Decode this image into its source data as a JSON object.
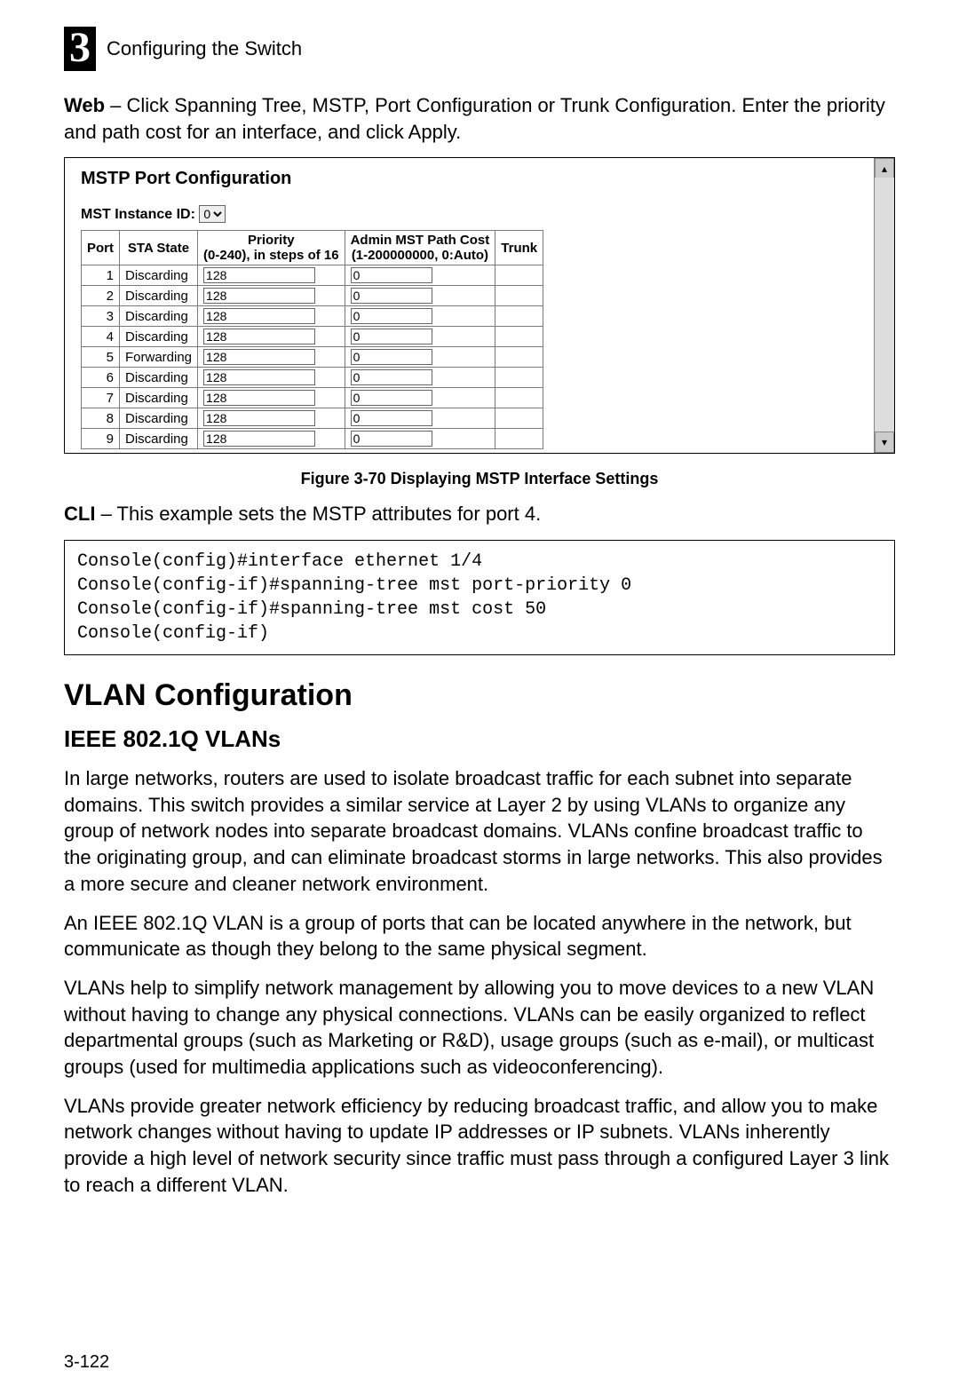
{
  "header": {
    "chapter_number": "3",
    "chapter_title": "Configuring the Switch"
  },
  "intro": {
    "label": "Web",
    "text": " – Click Spanning Tree, MSTP, Port Configuration or Trunk Configuration. Enter the priority and path cost for an interface, and click Apply."
  },
  "screenshot": {
    "title": "MSTP Port Configuration",
    "mst_label": "MST Instance ID:",
    "mst_value": "0",
    "columns": {
      "port": "Port",
      "sta_state": "STA State",
      "priority_l1": "Priority",
      "priority_l2": "(0-240), in steps of 16",
      "path_l1": "Admin MST Path Cost",
      "path_l2": "(1-200000000, 0:Auto)",
      "trunk": "Trunk"
    },
    "rows": [
      {
        "port": "1",
        "state": "Discarding",
        "priority": "128",
        "cost": "0",
        "trunk": ""
      },
      {
        "port": "2",
        "state": "Discarding",
        "priority": "128",
        "cost": "0",
        "trunk": ""
      },
      {
        "port": "3",
        "state": "Discarding",
        "priority": "128",
        "cost": "0",
        "trunk": ""
      },
      {
        "port": "4",
        "state": "Discarding",
        "priority": "128",
        "cost": "0",
        "trunk": ""
      },
      {
        "port": "5",
        "state": "Forwarding",
        "priority": "128",
        "cost": "0",
        "trunk": ""
      },
      {
        "port": "6",
        "state": "Discarding",
        "priority": "128",
        "cost": "0",
        "trunk": ""
      },
      {
        "port": "7",
        "state": "Discarding",
        "priority": "128",
        "cost": "0",
        "trunk": ""
      },
      {
        "port": "8",
        "state": "Discarding",
        "priority": "128",
        "cost": "0",
        "trunk": ""
      },
      {
        "port": "9",
        "state": "Discarding",
        "priority": "128",
        "cost": "0",
        "trunk": ""
      }
    ]
  },
  "figure_caption": "Figure 3-70  Displaying MSTP Interface Settings",
  "cli_intro": {
    "label": "CLI",
    "text": " – This example sets the MSTP attributes for port 4."
  },
  "cli_block": "Console(config)#interface ethernet 1/4\nConsole(config-if)#spanning-tree mst port-priority 0\nConsole(config-if)#spanning-tree mst cost 50\nConsole(config-if)",
  "section_heading": "VLAN Configuration",
  "subsection_heading": "IEEE 802.1Q VLANs",
  "body": {
    "p1": "In large networks, routers are used to isolate broadcast traffic for each subnet into separate domains. This switch provides a similar service at Layer 2 by using VLANs to organize any group of network nodes into separate broadcast domains. VLANs confine broadcast traffic to the originating group, and can eliminate broadcast storms in large networks. This also provides a more secure and cleaner network environment.",
    "p2": "An IEEE 802.1Q VLAN is a group of ports that can be located anywhere in the network, but communicate as though they belong to the same physical segment.",
    "p3": "VLANs help to simplify network management by allowing you to move devices to a new VLAN without having to change any physical connections. VLANs can be easily organized to reflect departmental groups (such as Marketing or R&D), usage groups (such as e-mail), or multicast groups (used for multimedia applications such as videoconferencing).",
    "p4": "VLANs provide greater network efficiency by reducing broadcast traffic, and allow you to make network changes without having to update IP addresses or IP subnets. VLANs inherently provide a high level of network security since traffic must pass through a configured Layer 3 link to reach a different VLAN."
  },
  "page_number": "3-122"
}
